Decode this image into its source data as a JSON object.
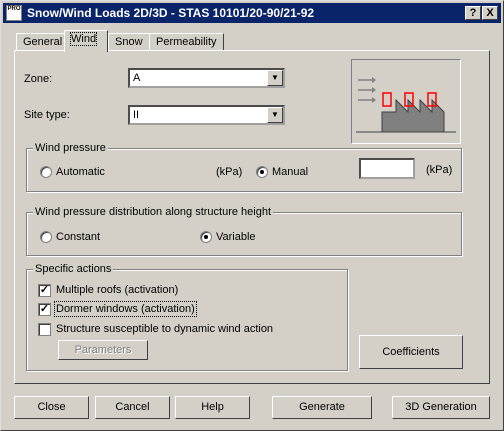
{
  "window": {
    "title": "Snow/Wind Loads 2D/3D - STAS 10101/20-90/21-92",
    "icon_text": "PRO",
    "help_btn": "?",
    "close_btn": "X"
  },
  "tabs": [
    {
      "label": "General"
    },
    {
      "label": "Wind"
    },
    {
      "label": "Snow"
    },
    {
      "label": "Permeability"
    }
  ],
  "active_tab": "Wind",
  "zone": {
    "label": "Zone:",
    "value": "A"
  },
  "site_type": {
    "label": "Site type:",
    "value": "II"
  },
  "wind_pressure": {
    "legend": "Wind pressure",
    "automatic": "Automatic",
    "unit_auto": "(kPa)",
    "manual": "Manual",
    "manual_value": "",
    "unit_manual": "(kPa)",
    "selected": "manual"
  },
  "distribution": {
    "legend": "Wind pressure distribution along structure height",
    "constant": "Constant",
    "variable": "Variable",
    "selected": "variable"
  },
  "specific_actions": {
    "legend": "Specific actions",
    "items": [
      {
        "label": "Multiple roofs (activation)",
        "checked": true
      },
      {
        "label": "Dormer windows (activation)",
        "checked": true
      },
      {
        "label": "Structure susceptible to dynamic wind action",
        "checked": false
      }
    ],
    "parameters_button": "Parameters"
  },
  "coefficients_button": "Coefficients",
  "footer": {
    "close": "Close",
    "cancel": "Cancel",
    "help": "Help",
    "generate": "Generate",
    "generation_3d": "3D Generation"
  },
  "colors": {
    "titlebar": "#0a246a",
    "face": "#d4d0c8",
    "dormer_outline": "#ff0000",
    "building_fill": "#808080"
  }
}
